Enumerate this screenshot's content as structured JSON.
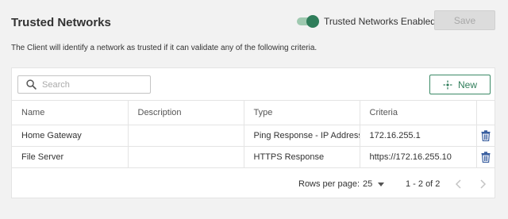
{
  "header": {
    "title": "Trusted Networks",
    "toggle_label": "Trusted Networks Enabled",
    "toggle_on": true,
    "save_label": "Save"
  },
  "description": "The Client will identify a network as trusted if it can validate any of the following criteria.",
  "toolbar": {
    "search_placeholder": "Search",
    "search_value": "",
    "new_label": "New"
  },
  "table": {
    "columns": [
      "Name",
      "Description",
      "Type",
      "Criteria"
    ],
    "rows": [
      {
        "name": "Home Gateway",
        "description": "",
        "type": "Ping Response - IP Address",
        "criteria": "172.16.255.1"
      },
      {
        "name": "File Server",
        "description": "",
        "type": "HTTPS Response",
        "criteria": "https://172.16.255.10"
      }
    ]
  },
  "pagination": {
    "rows_per_page_label": "Rows per page:",
    "rows_per_page": "25",
    "range": "1 - 2 of 2"
  },
  "colors": {
    "accent": "#2f7d5a",
    "toggle_track": "#9fc9b0",
    "delete_icon": "#3a5fa0",
    "disabled_button": "#dcdcdc",
    "background": "#f2f2f2"
  }
}
